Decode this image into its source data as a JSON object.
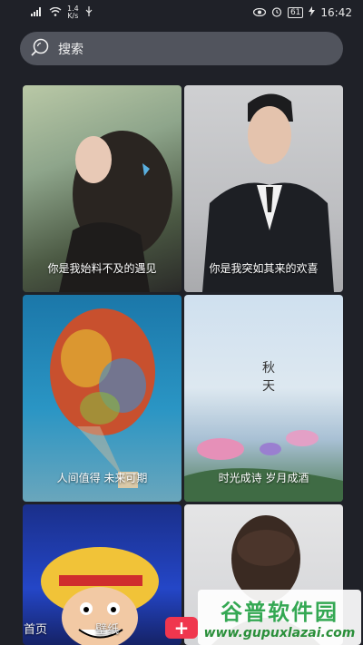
{
  "status_bar": {
    "net_speed_value": "1.4",
    "net_speed_unit": "K/s",
    "battery": "61",
    "time": "16:42"
  },
  "search": {
    "label": "搜索",
    "icon": "search-icon"
  },
  "cards": [
    {
      "caption": "你是我始料不及的遇见"
    },
    {
      "caption": "你是我突如其来的欢喜"
    },
    {
      "caption": "人间值得 未来可期"
    },
    {
      "caption": "时光成诗 岁月成酒",
      "overlay_text": [
        "秋",
        "天"
      ]
    },
    {
      "caption": ""
    },
    {
      "caption": ""
    }
  ],
  "bottom_nav": {
    "home": "首页",
    "wallpaper": "壁纸",
    "add": "+"
  },
  "watermark": {
    "title": "谷普软件园",
    "url": "www.gupuxlazai.com"
  },
  "colors": {
    "background": "#1f2128",
    "search_bg": "#51545d",
    "accent": "#f0364e"
  }
}
